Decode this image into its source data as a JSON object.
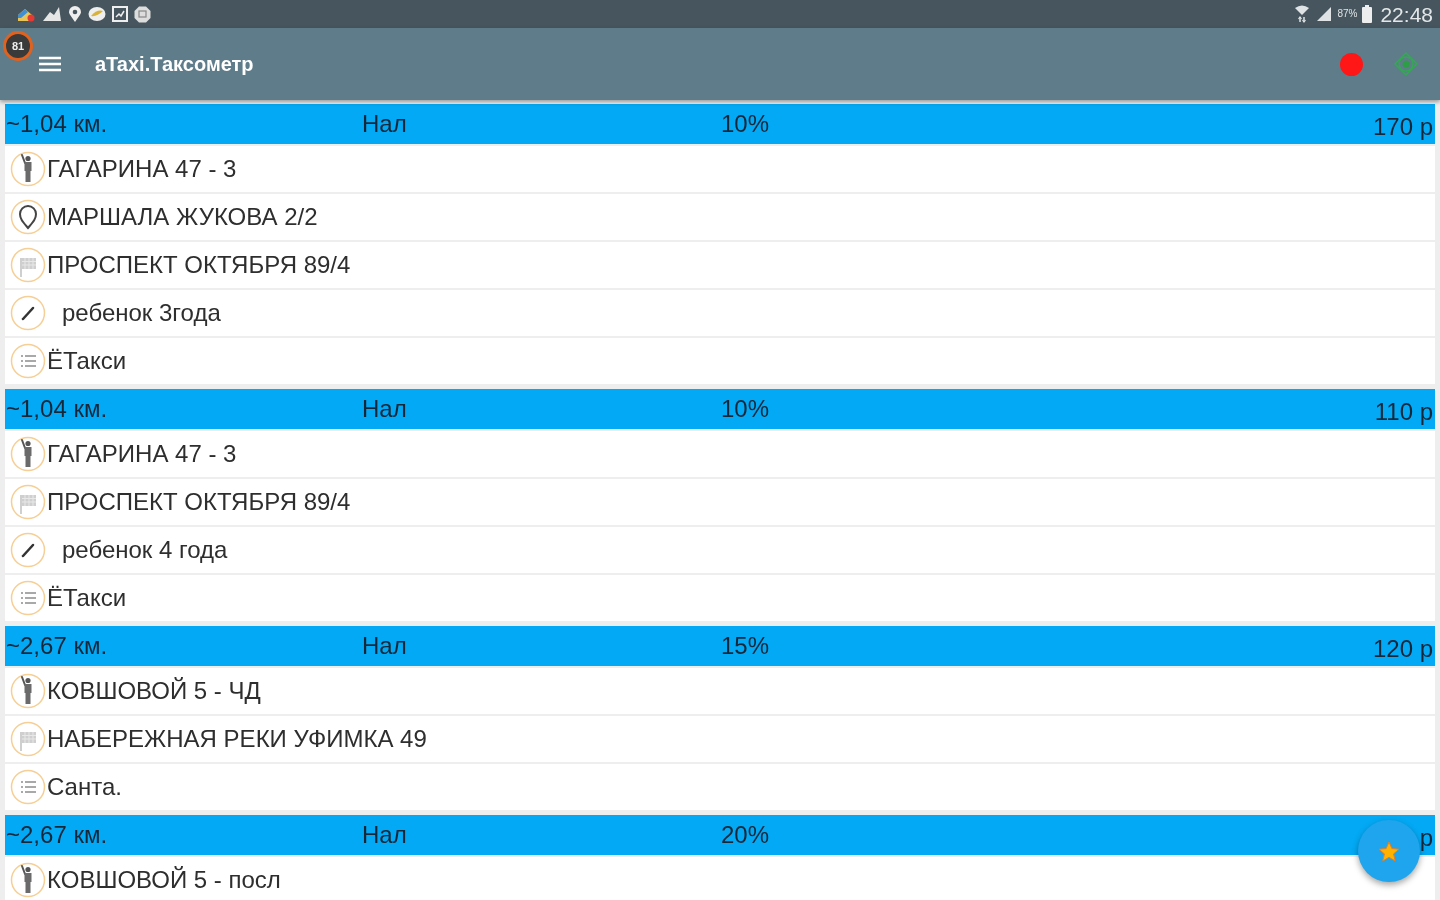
{
  "status_bar": {
    "battery_percent": "87%",
    "time": "22:48"
  },
  "app_bar": {
    "badge": "81",
    "title": "aTaxi.Таксометр"
  },
  "orders": [
    {
      "distance": "~1,04 км.",
      "payment": "Нал",
      "commission": "10%",
      "price": "170 р",
      "rows": [
        {
          "kind": "pickup",
          "text": "ГАГАРИНА 47 - 3"
        },
        {
          "kind": "waypoint",
          "text": "МАРШАЛА ЖУКОВА 2/2"
        },
        {
          "kind": "destination",
          "text": "ПРОСПЕКТ ОКТЯБРЯ 89/4"
        },
        {
          "kind": "comment",
          "text": "ребенок 3года"
        },
        {
          "kind": "service",
          "text": "ЁТакси"
        }
      ]
    },
    {
      "distance": "~1,04 км.",
      "payment": "Нал",
      "commission": "10%",
      "price": "110 р",
      "rows": [
        {
          "kind": "pickup",
          "text": "ГАГАРИНА 47 - 3"
        },
        {
          "kind": "destination",
          "text": "ПРОСПЕКТ ОКТЯБРЯ 89/4"
        },
        {
          "kind": "comment",
          "text": "ребенок 4 года"
        },
        {
          "kind": "service",
          "text": "ЁТакси"
        }
      ]
    },
    {
      "distance": "~2,67 км.",
      "payment": "Нал",
      "commission": "15%",
      "price": "120 р",
      "rows": [
        {
          "kind": "pickup",
          "text": "КОВШОВОЙ 5 - ЧД"
        },
        {
          "kind": "destination",
          "text": "НАБЕРЕЖНАЯ РЕКИ УФИМКА 49"
        },
        {
          "kind": "service",
          "text": "Санта."
        }
      ]
    },
    {
      "distance": "~2,67 км.",
      "payment": "Нал",
      "commission": "20%",
      "price": "р",
      "rows": [
        {
          "kind": "pickup",
          "text": "КОВШОВОЙ 5 - посл"
        }
      ]
    }
  ]
}
